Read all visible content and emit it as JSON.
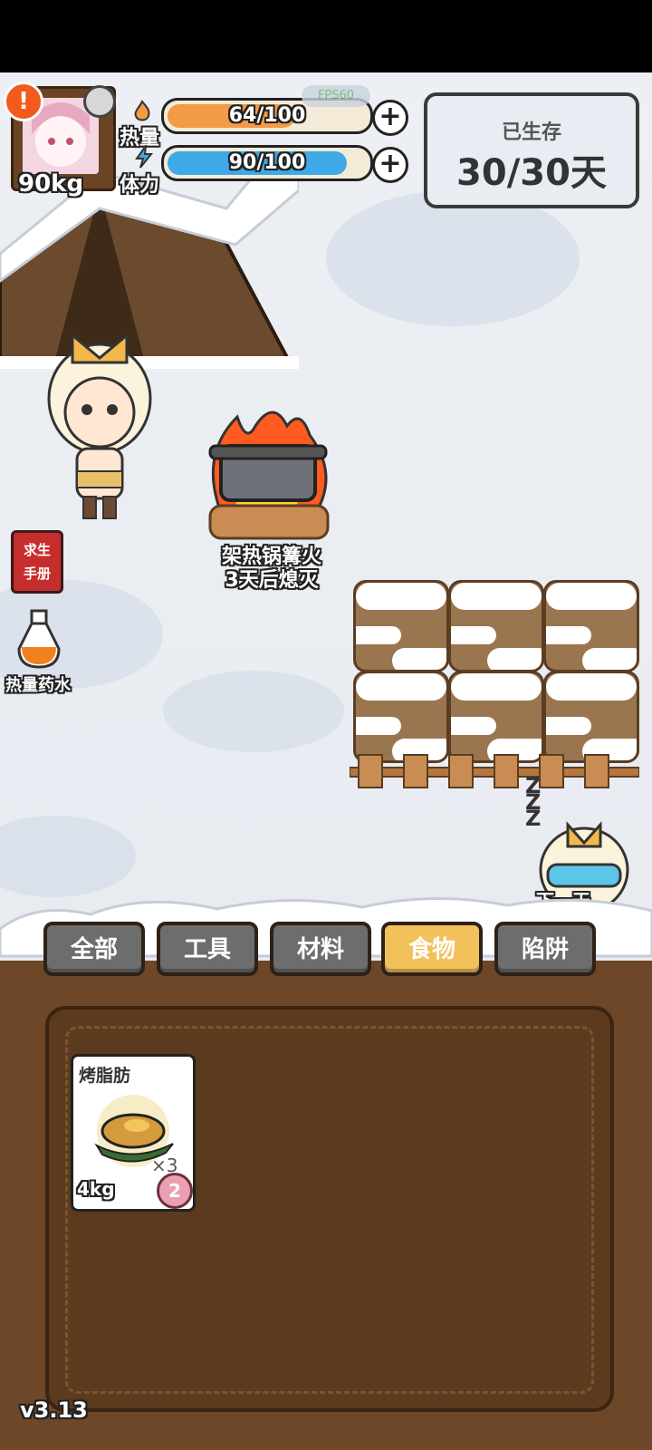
{
  "hud": {
    "weight": "90kg",
    "alert_glyph": "!",
    "heat": {
      "label": "热量",
      "text": "64/100",
      "level": 0.64,
      "color": "#f29a45",
      "icon": "flame-icon"
    },
    "stamina": {
      "label": "体力",
      "text": "90/100",
      "level": 0.9,
      "color": "#3fa8e6",
      "icon": "lightning-icon"
    },
    "plus_glyph": "+",
    "fps": "FPS60"
  },
  "days": {
    "title": "已生存",
    "value": "30/30天"
  },
  "left_tools": {
    "handbook": "求生\n手册",
    "potion": "热量药水"
  },
  "campfire": {
    "line1": "架热锅篝火",
    "line2": "3天后熄灭"
  },
  "next_day": {
    "label": "下一天",
    "sleep_glyph": "Z Z Z"
  },
  "tabs": [
    {
      "label": "全部",
      "active": false
    },
    {
      "label": "工具",
      "active": false
    },
    {
      "label": "材料",
      "active": false
    },
    {
      "label": "食物",
      "active": true
    },
    {
      "label": "陷阱",
      "active": false
    }
  ],
  "inventory": {
    "items": [
      {
        "name": "烤脂肪",
        "count": "×3",
        "weight": "4kg",
        "badge": "2"
      }
    ]
  },
  "version": "v3.13"
}
